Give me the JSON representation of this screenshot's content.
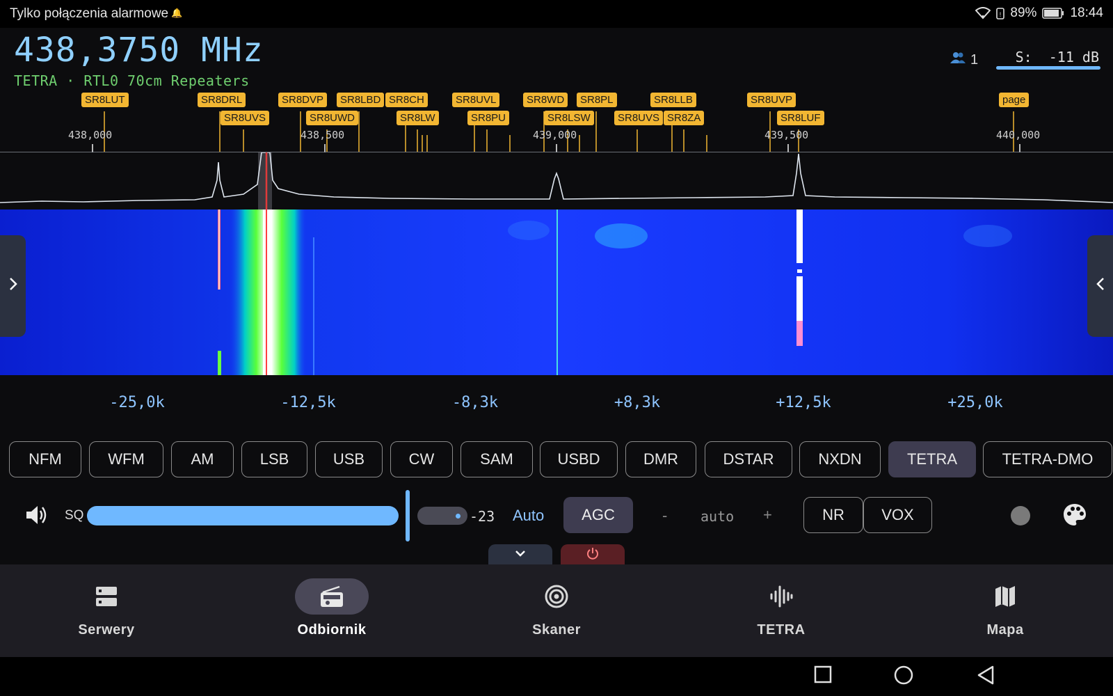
{
  "status_bar": {
    "left_text": "Tylko połączenia alarmowe",
    "battery": "89%",
    "time": "18:44",
    "icons": [
      "wifi-icon",
      "battery-saver-icon",
      "battery-icon"
    ]
  },
  "header": {
    "frequency": "438,3750 MHz",
    "subtitle": "TETRA · RTL0 70cm Repeaters",
    "users_count": "1",
    "signal": "S:  -11 dB"
  },
  "band_labels": [
    "SR8LUT",
    "SR8DRL",
    "SR8UVS",
    "SR8DVP",
    "SR8UWD",
    "SR8LBD",
    "SR8CH",
    "SR8LW",
    "SR8UVL",
    "SR8PU",
    "SR8WD",
    "SR8LSW",
    "SR8PL",
    "SR8UVS",
    "SR8LLB",
    "SR8ZA",
    "SR8UVP",
    "SR8LUF",
    "page"
  ],
  "axis_ticks": [
    "438,000",
    "438,500",
    "439,000",
    "439,500",
    "440,000"
  ],
  "offsets": [
    "-25,0k",
    "-12,5k",
    "-8,3k",
    "+8,3k",
    "+12,5k",
    "+25,0k"
  ],
  "modes": {
    "items": [
      "NFM",
      "WFM",
      "AM",
      "LSB",
      "USB",
      "CW",
      "SAM",
      "USBD",
      "DMR",
      "DSTAR",
      "NXDN",
      "TETRA",
      "TETRA-DMO"
    ],
    "selected": "TETRA"
  },
  "controls": {
    "sq_label": "SQ",
    "sq_value": "-23",
    "auto_label": "Auto",
    "agc_label": "AGC",
    "minus": "-",
    "gain_value": "auto",
    "plus": "+",
    "nr_label": "NR",
    "vox_label": "VOX"
  },
  "bottom_nav": [
    {
      "label": "Serwery",
      "icon": "server-icon"
    },
    {
      "label": "Odbiornik",
      "icon": "radio-icon",
      "active": true
    },
    {
      "label": "Skaner",
      "icon": "scanner-icon"
    },
    {
      "label": "TETRA",
      "icon": "waveform-icon"
    },
    {
      "label": "Mapa",
      "icon": "map-icon"
    }
  ],
  "colors": {
    "accent": "#6fb8ff",
    "frequency": "#8fd0ff",
    "subtitle": "#6fcf6f",
    "band_label": "#f2b632",
    "active_button": "#3e3c50"
  }
}
